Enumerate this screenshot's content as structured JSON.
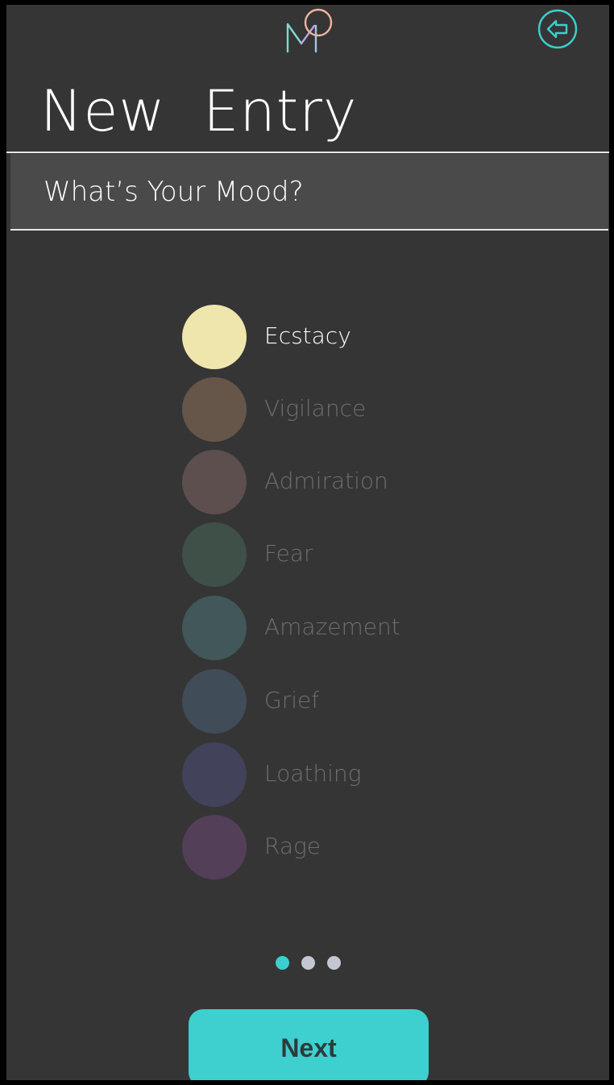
{
  "header": {
    "title": "New  Entry",
    "logo_icon": "m-logo-icon",
    "back_icon": "back-arrow-icon",
    "accent_color": "#3ccfcf"
  },
  "section": {
    "label": "What’s Your Mood?"
  },
  "moods": [
    {
      "label": "Ecstacy",
      "color": "#efe6ad",
      "selected": true
    },
    {
      "label": "Vigilance",
      "color": "#66564a",
      "selected": false
    },
    {
      "label": "Admiration",
      "color": "#5e4f4f",
      "selected": false
    },
    {
      "label": "Fear",
      "color": "#3f5049",
      "selected": false
    },
    {
      "label": "Amazement",
      "color": "#41575a",
      "selected": false
    },
    {
      "label": "Grief",
      "color": "#414c59",
      "selected": false
    },
    {
      "label": "Loathing",
      "color": "#42435a",
      "selected": false
    },
    {
      "label": "Rage",
      "color": "#533f58",
      "selected": false
    }
  ],
  "pager": {
    "total": 3,
    "current": 1
  },
  "footer": {
    "next_label": "Next"
  }
}
